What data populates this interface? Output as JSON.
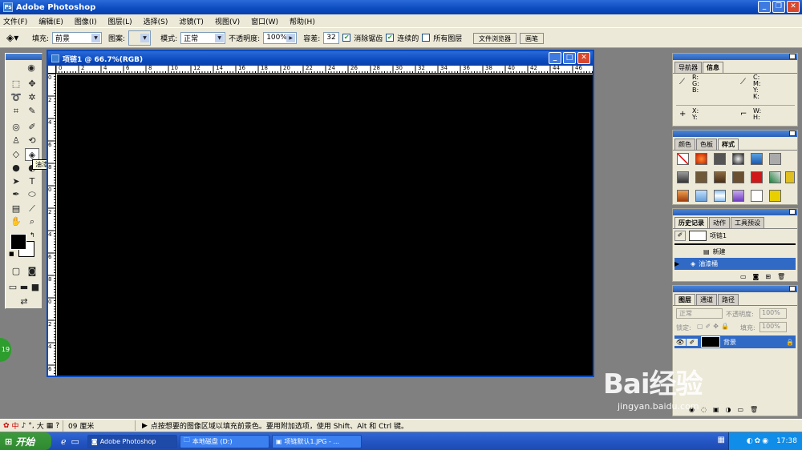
{
  "app": {
    "title": "Adobe Photoshop"
  },
  "menu": [
    "文件(F)",
    "编辑(E)",
    "图像(I)",
    "图层(L)",
    "选择(S)",
    "滤镜(T)",
    "视图(V)",
    "窗口(W)",
    "帮助(H)"
  ],
  "options": {
    "fill_label": "填充:",
    "fill_value": "前景",
    "pattern_label": "图案:",
    "mode_label": "模式:",
    "mode_value": "正常",
    "opacity_label": "不透明度:",
    "opacity_value": "100%",
    "tolerance_label": "容差:",
    "tolerance_value": "32",
    "antialias_label": "消除锯齿",
    "contiguous_label": "连续的",
    "all_layers_label": "所有图层",
    "palette_well_1": "文件浏览器",
    "palette_well_2": "画笔"
  },
  "tooltip": "油漆桶工具 (G)",
  "document": {
    "title": "项链1 @ 66.7%(RGB)",
    "h_ticks": [
      "0",
      "2",
      "4",
      "6",
      "8",
      "10",
      "12",
      "14",
      "16",
      "18",
      "20",
      "22",
      "24",
      "26",
      "28",
      "30",
      "32",
      "34",
      "36",
      "38",
      "40",
      "42",
      "44",
      "46"
    ],
    "v_ticks": [
      "0",
      "2",
      "4",
      "6",
      "8",
      "0",
      "2",
      "4",
      "6",
      "8",
      "0",
      "2",
      "4",
      "6"
    ]
  },
  "navigator_panel": {
    "tabs": [
      "导航器",
      "信息"
    ],
    "rgb_label": "R:\nG:\nB:",
    "cmyk_label": "C:\nM:\nY:\nK:",
    "xy_label": "X:\nY:",
    "wh_label": "W:\nH:"
  },
  "styles_panel": {
    "tabs": [
      "颜色",
      "色板",
      "样式"
    ]
  },
  "history_panel": {
    "tabs": [
      "历史记录",
      "动作",
      "工具预设"
    ],
    "snapshot": "项链1",
    "items": [
      "新建",
      "油漆桶"
    ]
  },
  "layers_panel": {
    "tabs": [
      "图层",
      "通道",
      "路径"
    ],
    "blend_mode": "正常",
    "opacity_label": "不透明度:",
    "opacity_value": "100%",
    "lock_label": "锁定:",
    "fill_label": "填充:",
    "fill_value": "100%",
    "layer_name": "背景"
  },
  "statusbar": {
    "ime": "中",
    "size": "09 厘米",
    "hint": "点按想要的图像区域以填充前景色。要用附加选项，使用 Shift、Alt 和 Ctrl 键。"
  },
  "taskbar": {
    "start": "开始",
    "tasks": [
      "Adobe Photoshop",
      "本地磁盘 (D:)",
      "项链默认1.JPG - ..."
    ],
    "clock": "17:38"
  },
  "watermark": {
    "brand": "Bai经验",
    "url": "jingyan.baidu.com"
  },
  "badge": "19",
  "colors": {
    "canvas": "#000000",
    "titlebar": "#0b4bc0",
    "chrome": "#ece9d8",
    "history_selected": "#316ac5"
  }
}
